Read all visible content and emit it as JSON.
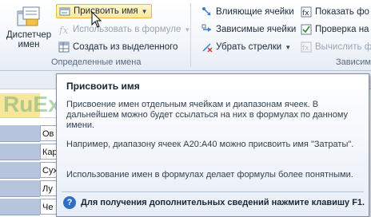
{
  "ribbon": {
    "manager": {
      "line1": "Диспетчер",
      "line2": "имен"
    },
    "define_name": "Присвоить имя",
    "use_in_formula": "Использовать в формуле",
    "create_from_selection": "Создать из выделенного",
    "group_defined_names": "Определенные имена",
    "trace_precedents": "Влияющие ячейки",
    "trace_dependents": "Зависимые ячейки",
    "remove_arrows": "Убрать стрелки",
    "show_formulas": "Показать фо",
    "error_checking": "Проверка на",
    "evaluate": "Вычислить ф",
    "group_dependencies": "Зависим"
  },
  "sheet": {
    "cells": [
      "Ов",
      "Кар",
      "Сух",
      "Лу",
      "Че"
    ]
  },
  "watermark": "RuExcel",
  "tooltip": {
    "title": "Присвоить имя",
    "p1": "Присвоение имен отдельным ячейкам и диапазонам ячеек. В дальнейшем можно будет ссылаться на них в формулах по данному имени.",
    "p2": "Например, диапазону ячеек A20:A40 можно присвоить имя \"Затраты\".",
    "p3": "Использование имен в формулах делает формулы более понятными.",
    "footer": "Для получения дополнительных сведений нажмите клавишу F1.",
    "help_glyph": "?"
  },
  "colors": {
    "highlight": "#ffe79c",
    "ribbon_bg": "#f4f7fb",
    "tooltip_border": "#7f8ea5"
  }
}
